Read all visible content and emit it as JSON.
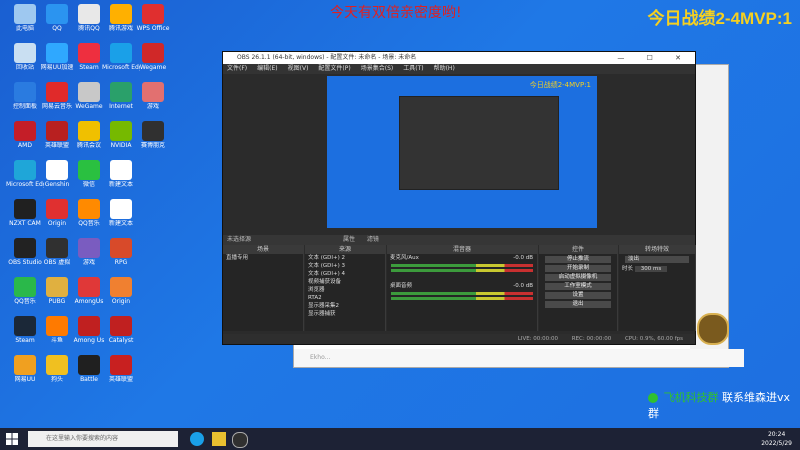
{
  "overlay": {
    "top_text": "今天有双倍亲密度哟!",
    "score_text": "今日战绩2-4MVP:1"
  },
  "desktop_icons": [
    {
      "label": "此电脑",
      "color": "#9ec8f0"
    },
    {
      "label": "QQ",
      "color": "#2b94f0"
    },
    {
      "label": "腾讯QQ",
      "color": "#e8e8e8"
    },
    {
      "label": "腾讯游戏",
      "color": "#ffb000"
    },
    {
      "label": "WPS Office",
      "color": "#e02f2f"
    },
    {
      "label": "回收站",
      "color": "#c9dff2"
    },
    {
      "label": "网易UU加速",
      "color": "#2fa8ff"
    },
    {
      "label": "Steam",
      "color": "#ee2f3f"
    },
    {
      "label": "Microsoft Edge",
      "color": "#1aa0e8"
    },
    {
      "label": "Wegame",
      "color": "#d02828"
    },
    {
      "label": "控制面板",
      "color": "#2a7be0"
    },
    {
      "label": "网易云音乐",
      "color": "#e02a2a"
    },
    {
      "label": "WeGame",
      "color": "#c8c8c8"
    },
    {
      "label": "Internet",
      "color": "#2aa06a"
    },
    {
      "label": "游戏",
      "color": "#e27070"
    },
    {
      "label": "AMD",
      "color": "#c41e28"
    },
    {
      "label": "英雄联盟",
      "color": "#b82020"
    },
    {
      "label": "腾讯会议",
      "color": "#f0c000"
    },
    {
      "label": "NVIDIA",
      "color": "#76b900"
    },
    {
      "label": "赛博朋克",
      "color": "#303030"
    },
    {
      "label": "Microsoft Edge",
      "color": "#1fa6d8"
    },
    {
      "label": "Genshin",
      "color": "#ffffff"
    },
    {
      "label": "微信",
      "color": "#2ac040"
    },
    {
      "label": "新建文本",
      "color": "#ffffff"
    },
    {
      "label": "NZXT CAM",
      "color": "#202020"
    },
    {
      "label": "Origin",
      "color": "#e03030"
    },
    {
      "label": "QQ音乐",
      "color": "#ff8a00"
    },
    {
      "label": "新建文本",
      "color": "#ffffff"
    },
    {
      "label": "OBS Studio",
      "color": "#222222"
    },
    {
      "label": "OBS 虚拟",
      "color": "#303030"
    },
    {
      "label": "游戏",
      "color": "#7a5cc0"
    },
    {
      "label": "RPG",
      "color": "#d84a2a"
    },
    {
      "label": "QQ音乐",
      "color": "#2ab84a"
    },
    {
      "label": "PUBG",
      "color": "#e0b040"
    },
    {
      "label": "AmongUs",
      "color": "#e03838"
    },
    {
      "label": "Origin",
      "color": "#f08030"
    },
    {
      "label": "Steam",
      "color": "#1b2838"
    },
    {
      "label": "斗鱼",
      "color": "#ff7a00"
    },
    {
      "label": "Among Us",
      "color": "#c02020"
    },
    {
      "label": "Catalyst",
      "color": "#c02020"
    },
    {
      "label": "网易UU",
      "color": "#f0a020"
    },
    {
      "label": "狗头",
      "color": "#f0c020"
    },
    {
      "label": "Battle",
      "color": "#202020"
    },
    {
      "label": "英雄联盟",
      "color": "#c82020"
    }
  ],
  "obs": {
    "title": "OBS 26.1.1 (64-bit, windows) - 配置文件: 未命名 - 场景: 未命名",
    "window_controls": "— ☐ ✕",
    "menu": [
      "文件(F)",
      "编辑(E)",
      "视图(V)",
      "配置文件(P)",
      "场景集合(S)",
      "工具(T)",
      "帮助(H)"
    ],
    "preview_overlay": "今日战绩2-4MVP:1",
    "scene_bar": "未选择源",
    "scene_bar_tabs": [
      "属性",
      "滤镜"
    ],
    "panels": {
      "scenes": {
        "header": "场景",
        "items": [
          "直播专用"
        ]
      },
      "sources": {
        "header": "来源",
        "items": [
          "文本 (GDI+) 2",
          "文本 (GDI+) 3",
          "文本 (GDI+) 4",
          "视频捕获设备",
          "浏览器",
          "RTA2",
          "显示器采集2",
          "显示器捕获"
        ]
      },
      "mixer": {
        "header": "混音器",
        "tracks": [
          {
            "name": "麦克风/Aux",
            "db": "-0.0 dB"
          },
          {
            "name": "桌面音频",
            "db": "-0.0 dB"
          }
        ]
      },
      "transitions": {
        "header": "转场特效",
        "fade": "淡出",
        "duration_label": "时长",
        "duration_value": "300 ms"
      },
      "controls": {
        "header": "控件",
        "buttons": [
          "停止推流",
          "开始录制",
          "启动虚拟摄像机",
          "工作室模式",
          "设置",
          "退出"
        ]
      }
    },
    "status": [
      "LIVE: 00:00:00",
      "REC: 00:00:00",
      "CPU: 0.9%, 60.00 fps"
    ]
  },
  "browser": {
    "bottom_hint": "Ekho..."
  },
  "wechat": {
    "green": "飞机科技群",
    "white": "联系维森进vx群"
  },
  "taskbar": {
    "search_placeholder": "在这里输入你要搜索的内容",
    "time": "20:24",
    "date": "2022/5/29"
  }
}
